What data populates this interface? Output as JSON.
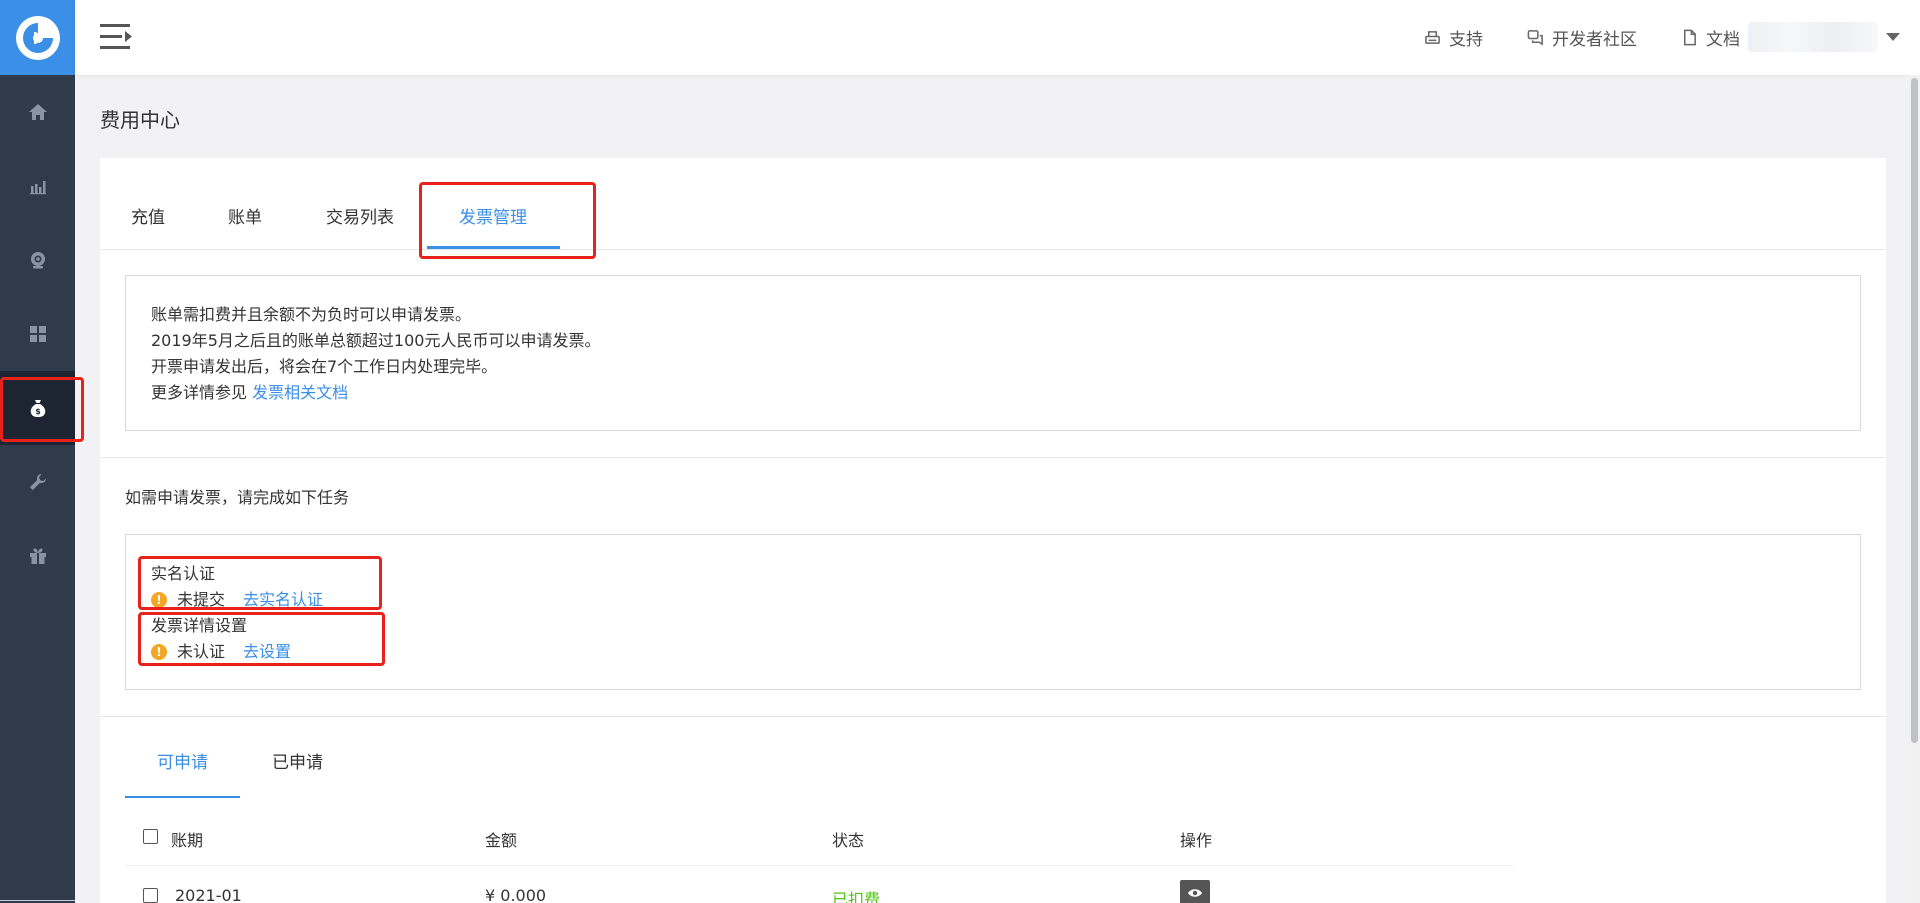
{
  "header": {
    "links": [
      {
        "label": "支持",
        "icon": "printer-icon"
      },
      {
        "label": "开发者社区",
        "icon": "chat-icon"
      },
      {
        "label": "文档",
        "icon": "document-icon"
      }
    ]
  },
  "sidebar": {
    "items": [
      {
        "icon": "home-icon"
      },
      {
        "icon": "bar-chart-icon"
      },
      {
        "icon": "camera-icon"
      },
      {
        "icon": "grid-icon"
      },
      {
        "icon": "money-bag-icon",
        "active": true
      },
      {
        "icon": "wrench-icon"
      },
      {
        "icon": "gift-icon"
      }
    ]
  },
  "page": {
    "title": "费用中心"
  },
  "tabs": [
    {
      "label": "充值"
    },
    {
      "label": "账单"
    },
    {
      "label": "交易列表"
    },
    {
      "label": "发票管理",
      "active": true
    }
  ],
  "notice": {
    "line1": "账单需扣费并且余额不为负时可以申请发票。",
    "line2": "2019年5月之后且的账单总额超过100元人民币可以申请发票。",
    "line3": "开票申请发出后，将会在7个工作日内处理完毕。",
    "line4_prefix": "更多详情参见",
    "line4_link": "发票相关文档"
  },
  "tasks": {
    "heading": "如需申请发票，请完成如下任务",
    "items": [
      {
        "title": "实名认证",
        "status": "未提交",
        "action": "去实名认证"
      },
      {
        "title": "发票详情设置",
        "status": "未认证",
        "action": "去设置"
      }
    ]
  },
  "subtabs": [
    {
      "label": "可申请",
      "active": true
    },
    {
      "label": "已申请"
    }
  ],
  "table": {
    "columns": [
      "账期",
      "金额",
      "状态",
      "操作"
    ],
    "rows": [
      {
        "period": "2021-01",
        "amount": "¥ 0.000",
        "status": "已扣费"
      }
    ]
  },
  "colors": {
    "accent": "#3a8ee6",
    "sidebar_bg": "#2f3a4b",
    "warning": "#f5a623",
    "success": "#52c41a",
    "annotation": "#e8211b"
  }
}
